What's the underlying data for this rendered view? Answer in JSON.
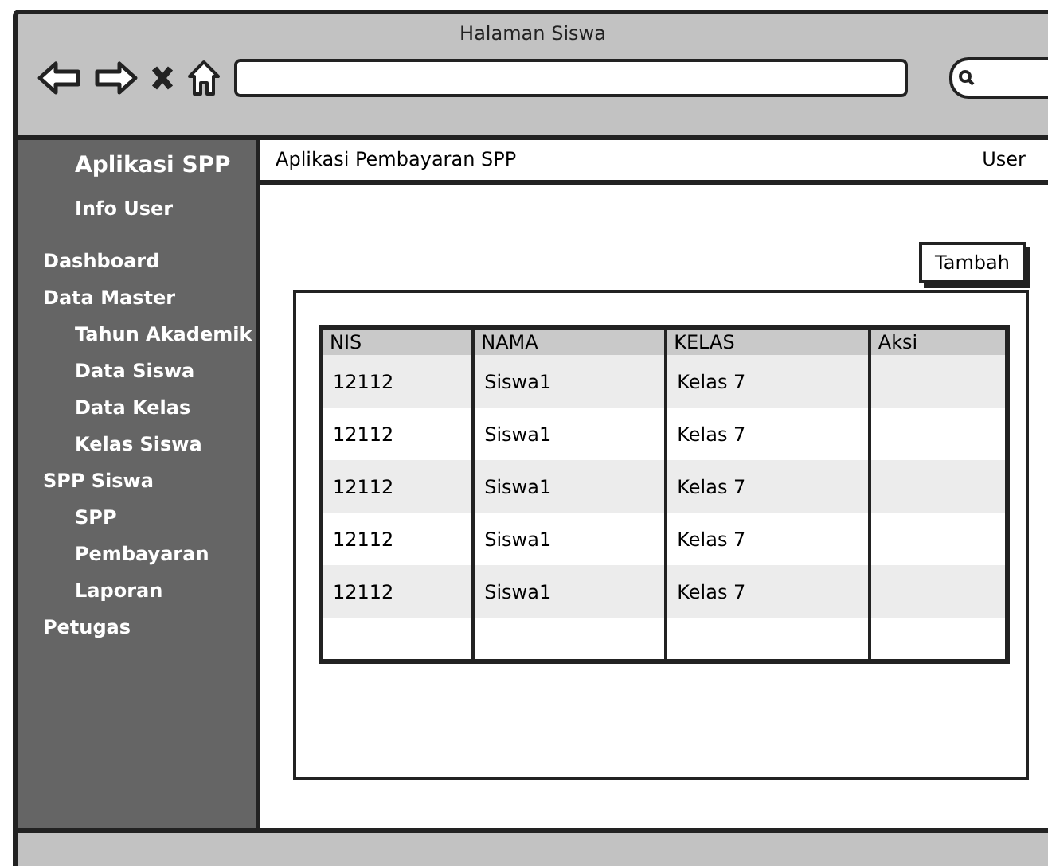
{
  "window": {
    "title": "Halaman Siswa"
  },
  "sidebar": {
    "title": "Aplikasi SPP",
    "user_info": "Info User",
    "items": [
      {
        "label": "Dashboard"
      },
      {
        "label": "Data Master",
        "children": [
          {
            "label": "Tahun Akademik"
          },
          {
            "label": "Data Siswa"
          },
          {
            "label": "Data Kelas"
          },
          {
            "label": "Kelas Siswa"
          }
        ]
      },
      {
        "label": "SPP Siswa",
        "children": [
          {
            "label": "SPP"
          },
          {
            "label": "Pembayaran"
          },
          {
            "label": "Laporan"
          }
        ]
      },
      {
        "label": "Petugas"
      }
    ]
  },
  "header": {
    "title": "Aplikasi Pembayaran SPP",
    "user": "User"
  },
  "add_button": "Tambah",
  "table": {
    "columns": [
      "NIS",
      "NAMA",
      "KELAS",
      "Aksi"
    ],
    "rows": [
      [
        "12112",
        "Siswa1",
        "Kelas 7"
      ],
      [
        "12112",
        "Siswa1",
        "Kelas 7"
      ],
      [
        "12112",
        "Siswa1",
        "Kelas 7"
      ],
      [
        "12112",
        "Siswa1",
        "Kelas 7"
      ],
      [
        "12112",
        "Siswa1",
        "Kelas 7"
      ]
    ]
  }
}
